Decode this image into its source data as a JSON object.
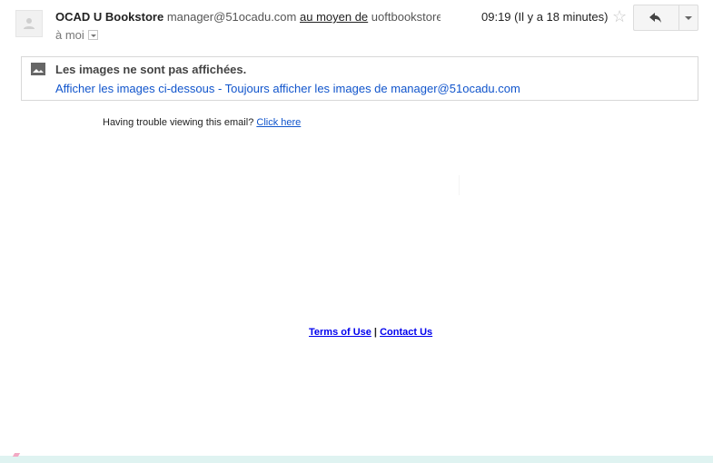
{
  "header": {
    "sender_name": "OCAD U Bookstore",
    "sender_email": "manager@51ocadu.com",
    "via_label": "au moyen de",
    "via_address": "uoftbookstore",
    "to_label": "à moi",
    "time": "09:19 (Il y a 18 minutes)",
    "icons": {
      "avatar": "person-icon",
      "star": "star-icon",
      "reply": "reply-icon",
      "more": "chevron-down-icon",
      "to_details": "chevron-down-icon"
    }
  },
  "image_notice": {
    "icon": "image-icon",
    "title": "Les images ne sont pas affichées.",
    "show_below": "Afficher les images ci-dessous",
    "separator": " - ",
    "always_show": "Toujours afficher les images de manager@51ocadu.com"
  },
  "body": {
    "trouble_text": "Having trouble viewing this email? ",
    "click_here": "Click here",
    "terms": "Terms of Use",
    "divider": " | ",
    "contact": "Contact Us"
  },
  "colors": {
    "link": "#1155cc",
    "footer_link": "#0000ee",
    "bottom_bar": "#dff3f1"
  }
}
